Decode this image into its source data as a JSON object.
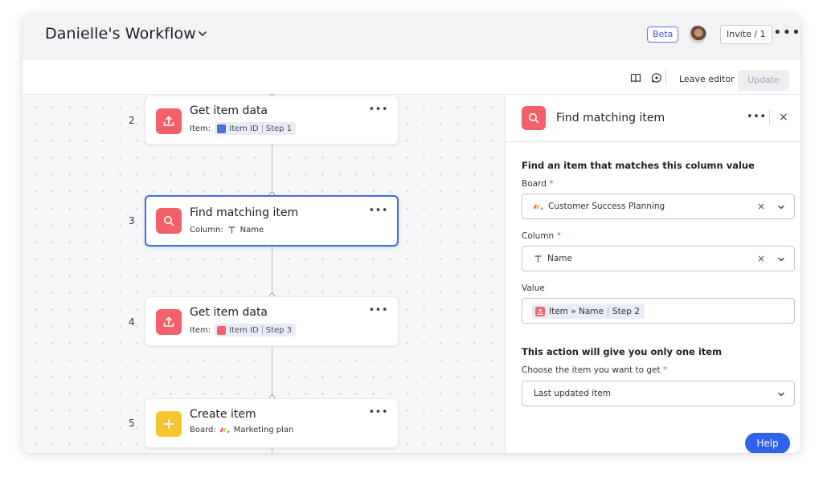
{
  "header": {
    "workflow_title": "Danielle's Workflow",
    "beta_badge": "Beta",
    "invite_label": "Invite / 1",
    "more_label": "•••"
  },
  "toolbar": {
    "leave_editor_label": "Leave editor",
    "update_label": "Update"
  },
  "steps": [
    {
      "number": "2",
      "title": "Get item data",
      "sub_label": "Item:",
      "chip_text": "Item ID",
      "chip_step": "Step 1",
      "icon": "upload-icon",
      "chip_icon": "column-icon",
      "chip_icon_color": "#4a6fe0"
    },
    {
      "number": "3",
      "title": "Find matching item",
      "sub_label": "Column:",
      "chip_text": "Name",
      "icon": "search-icon",
      "selected": true
    },
    {
      "number": "4",
      "title": "Get item data",
      "sub_label": "Item:",
      "chip_text": "Item ID",
      "chip_step": "Step 3",
      "icon": "upload-icon",
      "chip_icon": "search-icon",
      "chip_icon_color": "#f3606a"
    },
    {
      "number": "5",
      "title": "Create item",
      "sub_label": "Board:",
      "chip_text": "Marketing plan",
      "icon": "plus-icon",
      "icon_color": "#f6c630"
    }
  ],
  "card_more": "•••",
  "panel": {
    "title": "Find matching item",
    "more_label": "•••",
    "close_label": "×",
    "section1_title": "Find an item that matches this column value",
    "board_label": "Board",
    "board_value": "Customer Success Planning",
    "column_label": "Column",
    "column_value": "Name",
    "value_label": "Value",
    "value_chip_text": "Item » Name",
    "value_chip_step": "Step 2",
    "section2_title": "This action will give you only one item",
    "choose_label": "Choose the item you want to get",
    "choose_value": "Last updated item",
    "required_mark": "*",
    "clear_label": "×",
    "help_label": "Help"
  },
  "colors": {
    "accent": "#3f6ce3",
    "action_icon": "#f3606a",
    "create_icon": "#f6c630",
    "help_button": "#2f62ec"
  }
}
